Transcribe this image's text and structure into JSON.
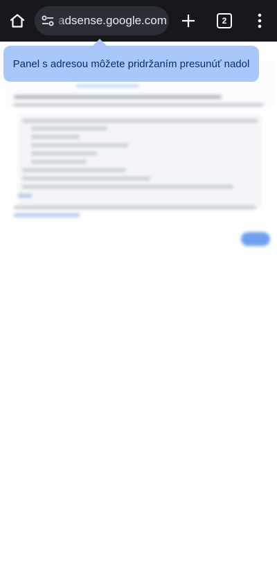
{
  "toolbar": {
    "home_icon": "home-icon",
    "site_settings_icon": "tune-icon",
    "url": "adsense.google.com",
    "new_tab_icon": "plus-icon",
    "tab_count": "2",
    "menu_icon": "more-vert-icon"
  },
  "tooltip": {
    "text": "Panel s adresou môžete pridržaním presunúť nadol",
    "background": "#a8c7fa"
  },
  "colors": {
    "toolbar_bg": "#16181c",
    "omnibox_bg": "#2b2f35",
    "accent": "#6fa0ef"
  }
}
